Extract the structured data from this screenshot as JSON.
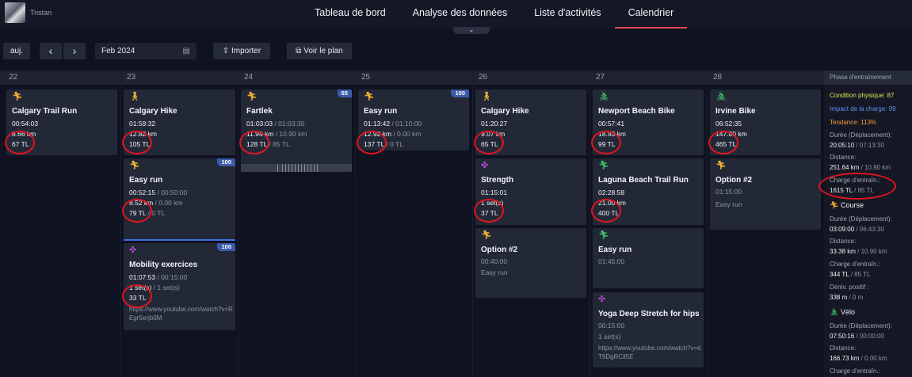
{
  "user": {
    "name": "Tristan"
  },
  "nav": {
    "tabs": [
      "Tableau de bord",
      "Analyse des données",
      "Liste d'activités",
      "Calendrier"
    ],
    "active": "Calendrier"
  },
  "toolbar": {
    "today": "auj.",
    "prev": "‹",
    "next": "›",
    "date": "Feb 2024",
    "import": "Importer",
    "plan": "Voir le plan"
  },
  "days": [
    "22",
    "23",
    "24",
    "25",
    "26",
    "27",
    "28"
  ],
  "activities": {
    "d22_1": {
      "title": "Calgary Trail Run",
      "l1": "00:54:03",
      "l2": "8.66 km",
      "l3": "67 TL"
    },
    "d23_1": {
      "title": "Calgary Hike",
      "l1": "01:59:32",
      "l2": "12.82 km",
      "l3": "105 TL"
    },
    "d23_2": {
      "title": "Easy run",
      "badge": "100",
      "l1": "00:52:15",
      "l1p": " / 00:50:00",
      "l2": "8.52 km",
      "l2p": " / 0.00 km",
      "l3": "79 TL",
      "l3p": " / 0 TL"
    },
    "d23_3": {
      "title": "Mobility exercices",
      "badge": "100",
      "l1": "01:07:53",
      "l1p": " / 00:15:00",
      "l2": "1 set(s)",
      "l2p": " / 1 set(s)",
      "l3": "33 TL",
      "note": "https://www.youtube.com/watch?v=REgr5erjb0M"
    },
    "d24_1": {
      "title": "Fartlek",
      "badge": "65",
      "l1": "01:03:03",
      "l1p": " / 01:03:30",
      "l2": "11.94 km",
      "l2p": " / 10.90 km",
      "l3": "128 TL",
      "l3p": " / 85 TL"
    },
    "d25_1": {
      "title": "Easy run",
      "badge": "100",
      "l1": "01:13:42",
      "l1p": " / 01:10:00",
      "l2": "12.92 km",
      "l2p": " / 0.00 km",
      "l3": "137 TL",
      "l3p": " / 0 TL"
    },
    "d26_1": {
      "title": "Calgary Hike",
      "l1": "01:20:27",
      "l2": "9.07 km",
      "l3": "65 TL"
    },
    "d26_2": {
      "title": "Strength",
      "l1": "01:15:01",
      "l2": "1 set(s)",
      "l3": "37 TL"
    },
    "d26_3": {
      "title": "Option #2",
      "l1": "00:40:00",
      "l2": "Easy run"
    },
    "d27_1": {
      "title": "Newport Beach Bike",
      "l1": "00:57:41",
      "l2": "18.93 km",
      "l3": "99 TL"
    },
    "d27_2": {
      "title": "Laguna Beach Trail Run",
      "l1": "02:28:58",
      "l2": "21.00 km",
      "l3": "400 TL"
    },
    "d27_3": {
      "title": "Easy run",
      "l1": "01:45:00"
    },
    "d27_4": {
      "title": "Yoga Deep Stretch for hips",
      "l1": "00:15:00",
      "l2": "1 set(s)",
      "note": "https://www.youtube.com/watch?v=dT9DgRCll5E"
    },
    "d28_1": {
      "title": "Irvine Bike",
      "l1": "06:52:35",
      "l2": "147.80 km",
      "l3": "465 TL"
    },
    "d28_2": {
      "title": "Option #2",
      "l1": "01:15:00",
      "l2": "Easy run"
    }
  },
  "sidebar": {
    "title": "Phase d'entraînement",
    "fitness": "Condition physique: 87",
    "load_impact": "Impact de la charge: 99",
    "trend": "Tendance: 113%",
    "dur_label": "Durée (Déplacement):",
    "dur_val": "20:05:10",
    "dur_plan": " / 07:13:30",
    "dist_label": "Distance:",
    "dist_val": "251.64 km",
    "dist_plan": " / 10.90 km",
    "load_label": "Charge d'entraîn.:",
    "load_val": "1615 TL",
    "load_plan": " / 85 TL",
    "run_title": "Course",
    "run_dur_label": "Durée (Déplacement):",
    "run_dur_val": "03:09:00",
    "run_dur_plan": " / 06:43:30",
    "run_dist_label": "Distance:",
    "run_dist_val": "33.38 km",
    "run_dist_plan": " / 10.90 km",
    "run_load_label": "Charge d'entraîn.:",
    "run_load_val": "344 TL",
    "run_load_plan": " / 85 TL",
    "run_elev_label": "Déniv. positif :",
    "run_elev_val": "338 m",
    "run_elev_plan": " / 0 m",
    "bike_title": "Vélo",
    "bike_dur_label": "Durée (Déplacement):",
    "bike_dur_val": "07:50:16",
    "bike_dur_plan": " / 00:00:00",
    "bike_dist_label": "Distance:",
    "bike_dist_val": "166.73 km",
    "bike_dist_plan": " / 0.00 km",
    "bike_load_label": "Charge d'entraîn.:"
  },
  "colors": {
    "run_icon": "#f2b233",
    "bike_icon": "#3fbf6a",
    "strength_icon": "#c04fe0",
    "annotation": "#e0151f"
  }
}
